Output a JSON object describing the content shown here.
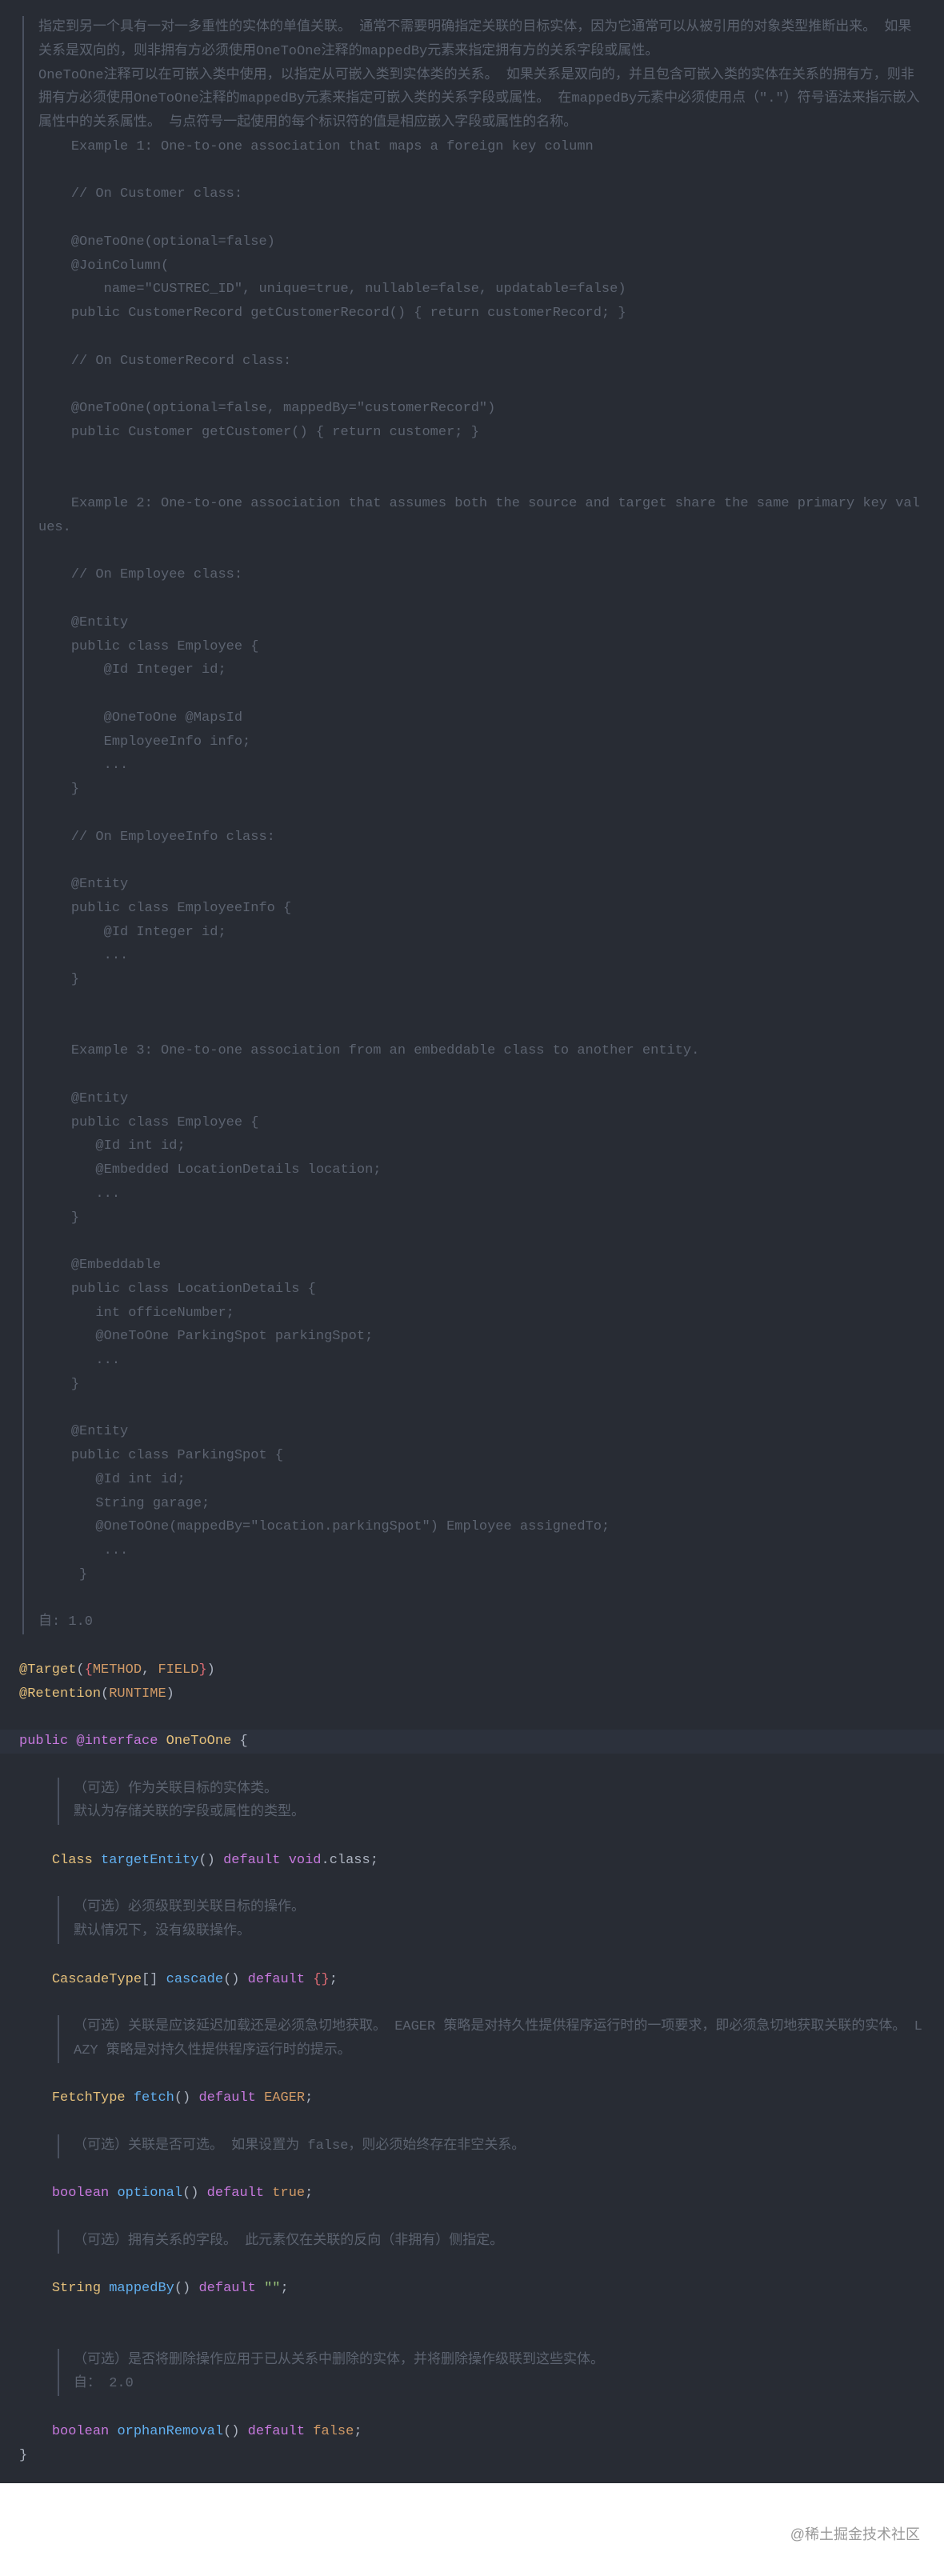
{
  "comment1_p1": "指定到另一个具有一对一多重性的实体的单值关联。 通常不需要明确指定关联的目标实体，因为它通常可以从被引用的对象类型推断出来。 如果关系是双向的，则非拥有方必须使用OneToOne注释的mappedBy元素来指定拥有方的关系字段或属性。",
  "comment1_p2": "OneToOne注释可以在可嵌入类中使用，以指定从可嵌入类到实体类的关系。 如果关系是双向的，并且包含可嵌入类的实体在关系的拥有方，则非拥有方必须使用OneToOne注释的mappedBy元素来指定可嵌入类的关系字段或属性。 在mappedBy元素中必须使用点（\".\"）符号语法来指示嵌入属性中的关系属性。 与点符号一起使用的每个标识符的值是相应嵌入字段或属性的名称。",
  "example1_title": "    Example 1: One-to-one association that maps a foreign key column",
  "example1_body": "\n    // On Customer class:\n\n    @OneToOne(optional=false)\n    @JoinColumn(\n    \tname=\"CUSTREC_ID\", unique=true, nullable=false, updatable=false)\n    public CustomerRecord getCustomerRecord() { return customerRecord; }\n\n    // On CustomerRecord class:\n\n    @OneToOne(optional=false, mappedBy=\"customerRecord\")\n    public Customer getCustomer() { return customer; }\n",
  "example2_title": "\n    Example 2: One-to-one association that assumes both the source and target share the same primary key values.",
  "example2_body": "\n    // On Employee class:\n\n    @Entity\n    public class Employee {\n    \t@Id Integer id;\n    \n    \t@OneToOne @MapsId\n    \tEmployeeInfo info;\n    \t...\n    }\n\n    // On EmployeeInfo class:\n\n    @Entity\n    public class EmployeeInfo {\n    \t@Id Integer id;\n    \t...\n    }\n",
  "example3_title": "\n    Example 3: One-to-one association from an embeddable class to another entity.",
  "example3_body": "\n    @Entity\n    public class Employee {\n       @Id int id;\n       @Embedded LocationDetails location;\n       ...\n    }\n\n    @Embeddable\n    public class LocationDetails {\n       int officeNumber;\n       @OneToOne ParkingSpot parkingSpot;\n       ...\n    }\n\n    @Entity\n    public class ParkingSpot {\n       @Id int id;\n       String garage;\n       @OneToOne(mappedBy=\"location.parkingSpot\") Employee assignedTo;\n        ... \n     } \n",
  "since": "自: 1.0",
  "ann_target": "@Target",
  "lbrace": "{",
  "rbrace": "}",
  "const_method": "METHOD",
  "const_field": "FIELD",
  "ann_retention": "@Retention",
  "const_runtime": "RUNTIME",
  "kw_public": "public",
  "kw_interface": "@interface",
  "cls_name": "OneToOne",
  "space_brace": " {",
  "comment_target1": "（可选）作为关联目标的实体类。",
  "comment_target2": "默认为存储关联的字段或属性的类型。",
  "type_class": "Class",
  "m_targetEntity": "targetEntity",
  "parens": "()",
  "kw_default": "default",
  "void_class": "void",
  "dot_class": ".class",
  "semi": ";",
  "comment_cascade1": "（可选）必须级联到关联目标的操作。",
  "comment_cascade2": "默认情况下，没有级联操作。",
  "type_cascade": "CascadeType",
  "brackets": "[]",
  "m_cascade": "cascade",
  "empty_braces": "{}",
  "comment_fetch": "（可选）关联是应该延迟加载还是必须急切地获取。 EAGER 策略是对持久性提供程序运行时的一项要求，即必须急切地获取关联的实体。 LAZY 策略是对持久性提供程序运行时的提示。",
  "type_fetch": "FetchType",
  "m_fetch": "fetch",
  "const_eager": "EAGER",
  "comment_optional": "（可选）关联是否可选。 如果设置为 false，则必须始终存在非空关系。",
  "kw_boolean": "boolean",
  "m_optional": "optional",
  "const_true": "true",
  "comment_mappedBy": "（可选）拥有关系的字段。 此元素仅在关联的反向（非拥有）侧指定。",
  "type_string": "String",
  "m_mappedBy": "mappedBy",
  "empty_str": "\"\"",
  "comment_orphan1": "（可选）是否将删除操作应用于已从关系中删除的实体，并将删除操作级联到这些实体。",
  "comment_orphan2": "自： 2.0",
  "m_orphanRemoval": "orphanRemoval",
  "const_false": "false",
  "close_brace": "}",
  "watermark": "@稀土掘金技术社区"
}
